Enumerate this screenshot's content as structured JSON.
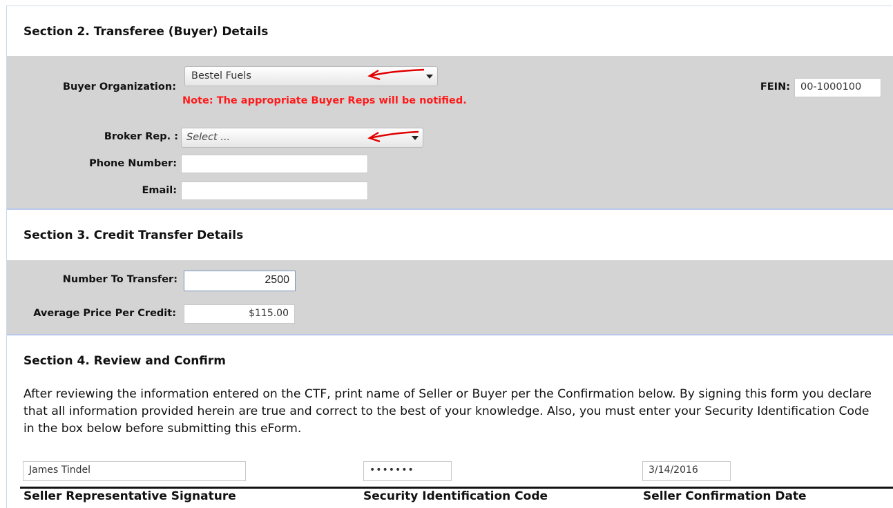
{
  "section2": {
    "title": "Section 2. Transferee (Buyer) Details",
    "buyer_org_label": "Buyer Organization:",
    "buyer_org_value": "Bestel Fuels",
    "note": "Note: The appropriate Buyer Reps will be notified.",
    "fein_label": "FEIN:",
    "fein_value": "00-1000100",
    "broker_label": "Broker Rep. :",
    "broker_value": "Select ...",
    "phone_label": "Phone Number:",
    "phone_value": "",
    "email_label": "Email:",
    "email_value": ""
  },
  "section3": {
    "title": "Section 3. Credit Transfer Details",
    "number_label": "Number To Transfer:",
    "number_value": "2500",
    "price_label": "Average Price Per Credit:",
    "price_value": "$115.00"
  },
  "section4": {
    "title": "Section 4. Review and Confirm",
    "paragraph": "After reviewing the information entered on the CTF, print name of Seller or Buyer per the Confirmation below.   By signing this form you declare that all information provided herein are true and correct to the best of your knowledge.   Also, you must enter your Security Identification Code in the box below before submitting this eForm.",
    "signature_value": "James Tindel",
    "security_code_value": "•••••••",
    "date_value": "3/14/2016",
    "signature_label": "Seller Representative Signature",
    "security_label": "Security Identification Code",
    "date_label": "Seller Confirmation Date"
  },
  "colors": {
    "note_red": "#ff1a1a",
    "arrow_red": "#e00000",
    "section_grey": "#d4d4d4",
    "divider_blue": "#b9c9ec"
  }
}
